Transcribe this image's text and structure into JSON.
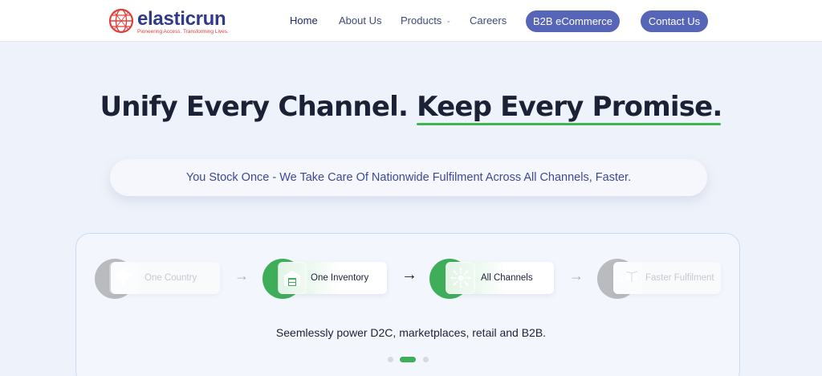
{
  "header": {
    "logo": {
      "wordmark": "elasticrun",
      "tagline": "Pioneering Access. Transforming Lives."
    },
    "nav": [
      {
        "label": "Home"
      },
      {
        "label": "About Us"
      },
      {
        "label": "Products"
      },
      {
        "label": "Careers"
      }
    ],
    "b2b_button": "B2B eCommerce",
    "contact_button": "Contact Us"
  },
  "hero": {
    "title_part1": "Unify Every Channel.",
    "title_part2": "Keep Every Promise.",
    "subtitle": "You Stock Once - We Take Care Of Nationwide Fulfilment Across All Channels, Faster."
  },
  "flow": {
    "steps": [
      {
        "label": "One Country",
        "icon": "india-map-icon",
        "state": "faded"
      },
      {
        "label": "One Inventory",
        "icon": "warehouse-icon",
        "state": "active"
      },
      {
        "label": "All Channels",
        "icon": "network-hub-icon",
        "state": "active"
      },
      {
        "label": "Faster Fulfilment",
        "icon": "fast-delivery-box-icon",
        "state": "faded"
      }
    ],
    "caption": "Seemlessly power D2C, marketplaces, retail and B2B.",
    "carousel": {
      "total": 3,
      "active": 2
    }
  },
  "colors": {
    "brand_navy": "#2f3b86",
    "brand_red": "#e0403a",
    "button": "#5765b8",
    "accent_green": "#3fb552",
    "subtitle": "#3c4a96"
  }
}
